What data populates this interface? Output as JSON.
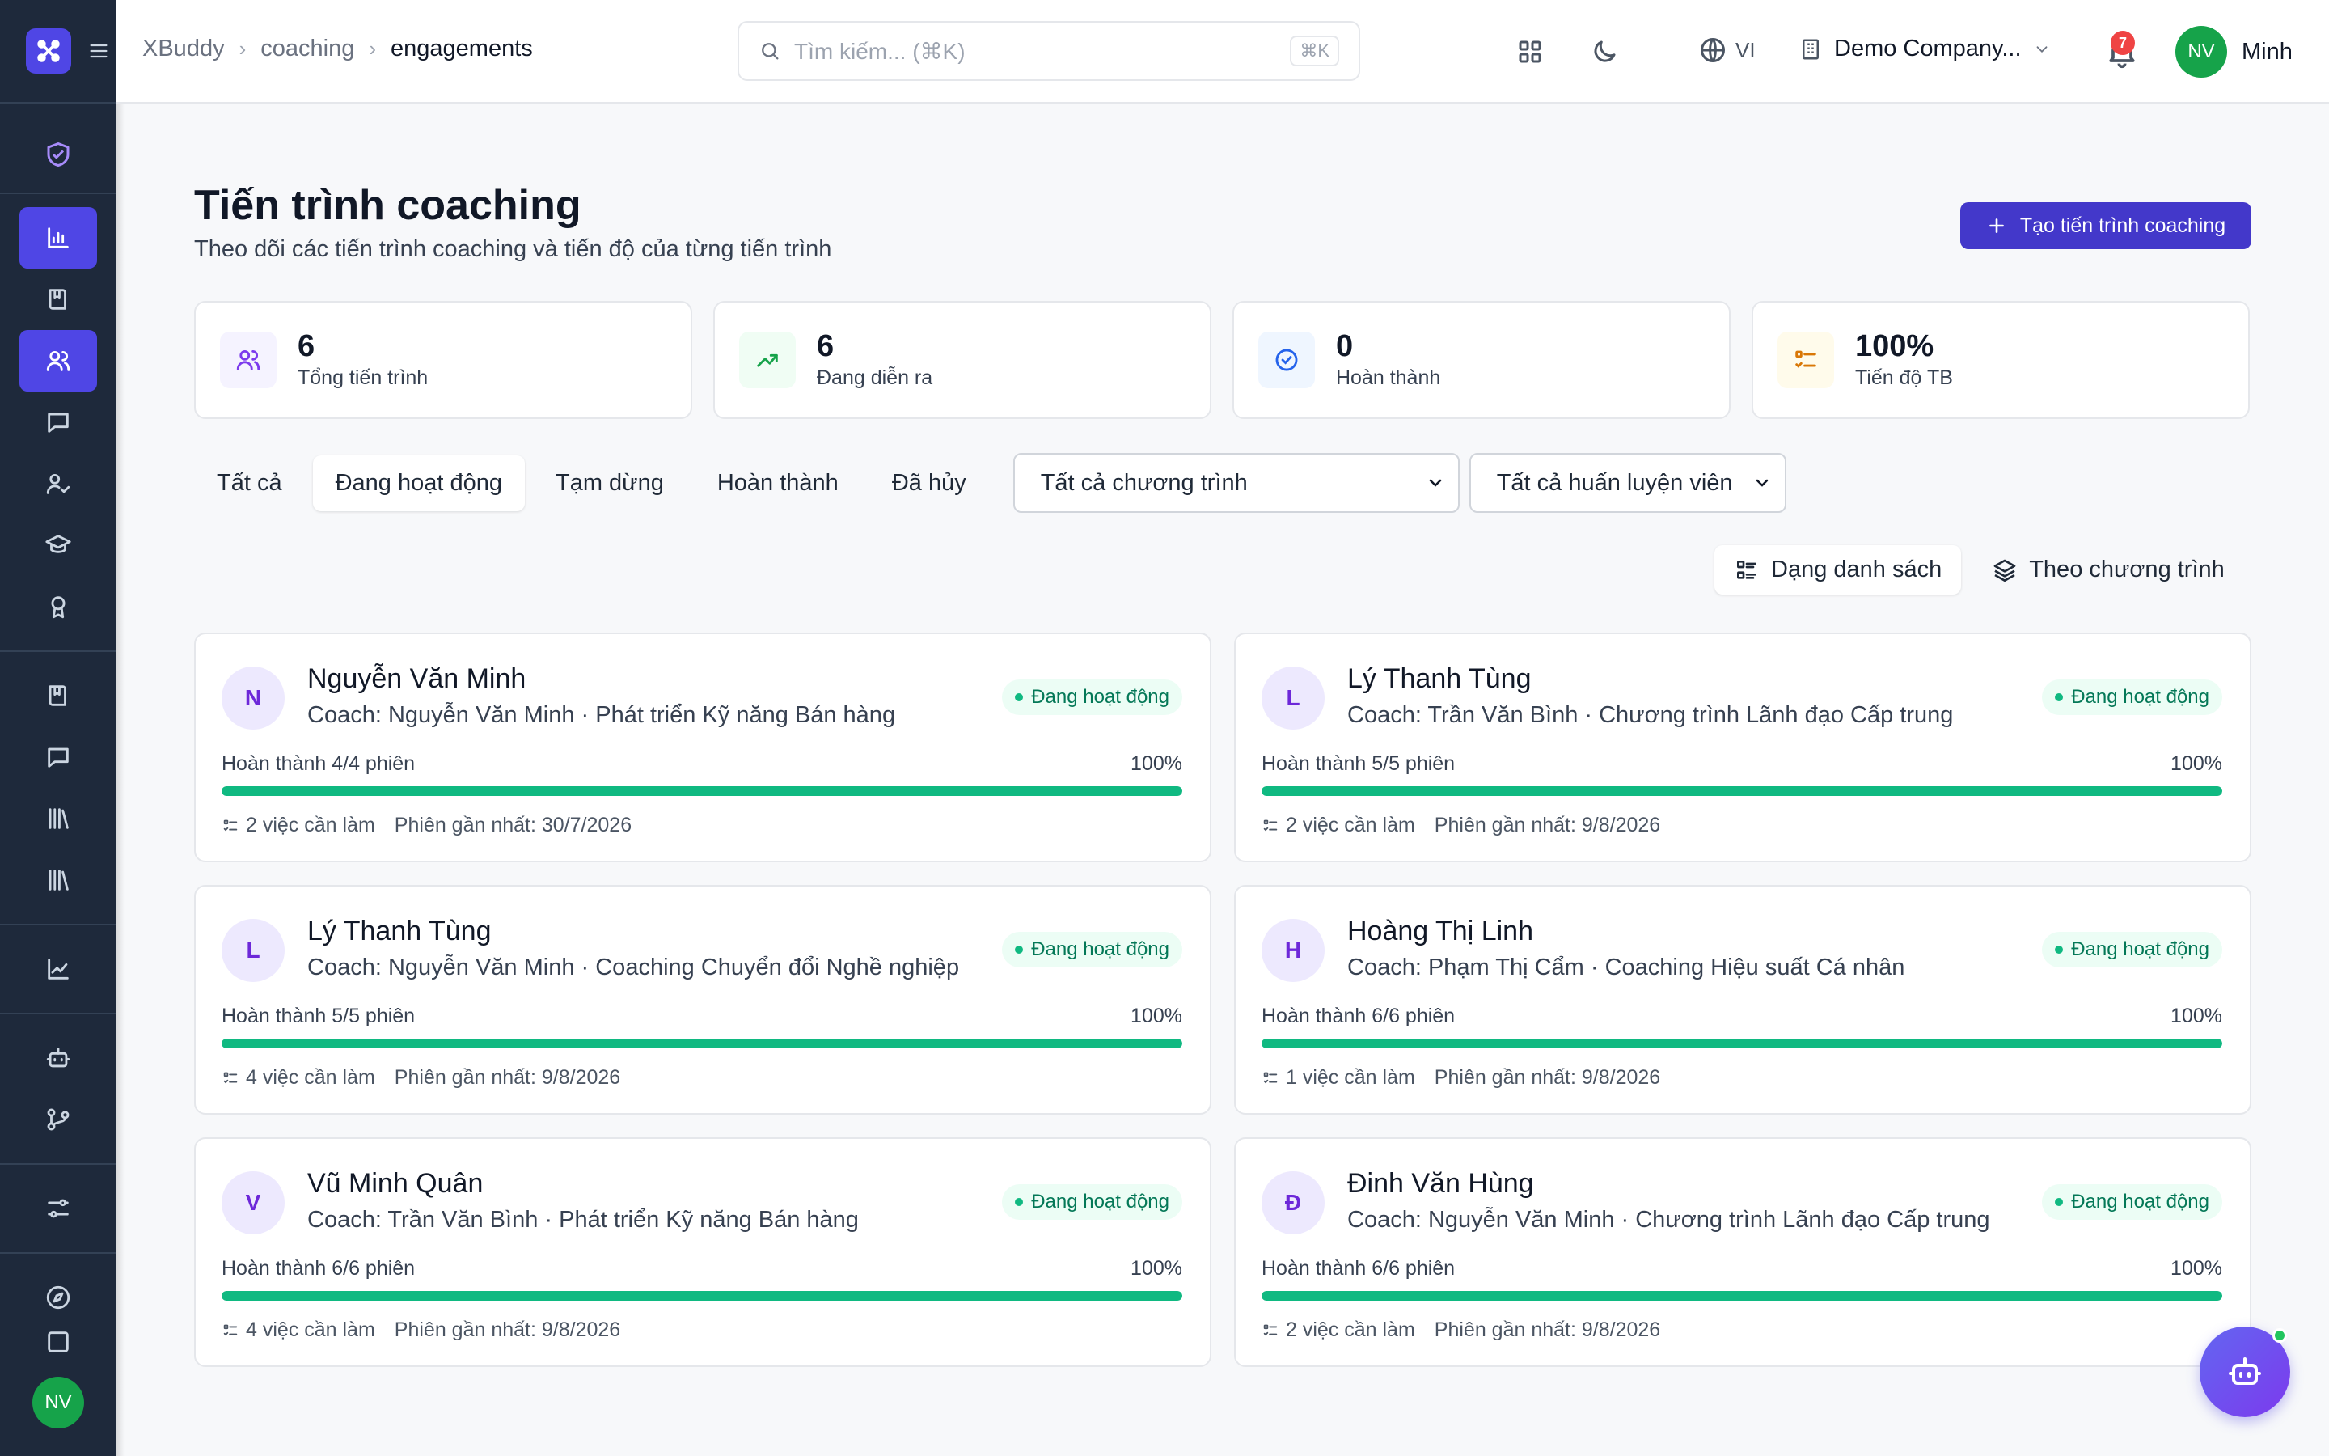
{
  "sidebar": {
    "user_initials": "NV"
  },
  "header": {
    "breadcrumb": [
      "XBuddy",
      "coaching",
      "engagements"
    ],
    "search_placeholder": "Tìm kiếm... (⌘K)",
    "search_shortcut": "⌘K",
    "language": "VI",
    "company": "Demo Company...",
    "notification_count": "7",
    "user_initials": "NV",
    "user_name": "Minh"
  },
  "page": {
    "title": "Tiến trình coaching",
    "subtitle": "Theo dõi các tiến trình coaching và tiến độ của từng tiến trình",
    "create_label": "Tạo tiến trình coaching"
  },
  "stats": [
    {
      "value": "6",
      "label": "Tổng tiến trình",
      "icon": "users-icon",
      "color": "#7c3aed",
      "bg": "#f5f3ff"
    },
    {
      "value": "6",
      "label": "Đang diễn ra",
      "icon": "trending-up-icon",
      "color": "#16a34a",
      "bg": "#f0fdf4"
    },
    {
      "value": "0",
      "label": "Hoàn thành",
      "icon": "check-circle-icon",
      "color": "#2563eb",
      "bg": "#eff6ff"
    },
    {
      "value": "100%",
      "label": "Tiến độ TB",
      "icon": "list-check-icon",
      "color": "#d97706",
      "bg": "#fffbeb"
    }
  ],
  "filters": {
    "tabs": [
      "Tất cả",
      "Đang hoạt động",
      "Tạm dừng",
      "Hoàn thành",
      "Đã hủy"
    ],
    "selected_tab": "Đang hoạt động",
    "program_select": "Tất cả chương trình",
    "coach_select": "Tất cả huấn luyện viên"
  },
  "view_options": [
    "Dạng danh sách",
    "Theo chương trình"
  ],
  "engagements": [
    {
      "initial": "N",
      "name": "Nguyễn Văn Minh",
      "meta": "Coach: Nguyễn Văn Minh · Phát triển Kỹ năng Bán hàng",
      "status": "Đang hoạt động",
      "progress_label": "Hoàn thành 4/4 phiên",
      "progress_pct": "100%",
      "progress": 1.0,
      "todos": "2 việc cần làm",
      "last_session": "Phiên gần nhất: 30/7/2026"
    },
    {
      "initial": "L",
      "name": "Lý Thanh Tùng",
      "meta": "Coach: Trần Văn Bình · Chương trình Lãnh đạo Cấp trung",
      "status": "Đang hoạt động",
      "progress_label": "Hoàn thành 5/5 phiên",
      "progress_pct": "100%",
      "progress": 1.0,
      "todos": "2 việc cần làm",
      "last_session": "Phiên gần nhất: 9/8/2026"
    },
    {
      "initial": "L",
      "name": "Lý Thanh Tùng",
      "meta": "Coach: Nguyễn Văn Minh · Coaching Chuyển đổi Nghề nghiệp",
      "status": "Đang hoạt động",
      "progress_label": "Hoàn thành 5/5 phiên",
      "progress_pct": "100%",
      "progress": 1.0,
      "todos": "4 việc cần làm",
      "last_session": "Phiên gần nhất: 9/8/2026"
    },
    {
      "initial": "H",
      "name": "Hoàng Thị Linh",
      "meta": "Coach: Phạm Thị Cẩm · Coaching Hiệu suất Cá nhân",
      "status": "Đang hoạt động",
      "progress_label": "Hoàn thành 6/6 phiên",
      "progress_pct": "100%",
      "progress": 1.0,
      "todos": "1 việc cần làm",
      "last_session": "Phiên gần nhất: 9/8/2026"
    },
    {
      "initial": "V",
      "name": "Vũ Minh Quân",
      "meta": "Coach: Trần Văn Bình · Phát triển Kỹ năng Bán hàng",
      "status": "Đang hoạt động",
      "progress_label": "Hoàn thành 6/6 phiên",
      "progress_pct": "100%",
      "progress": 1.0,
      "todos": "4 việc cần làm",
      "last_session": "Phiên gần nhất: 9/8/2026"
    },
    {
      "initial": "Đ",
      "name": "Đinh Văn Hùng",
      "meta": "Coach: Nguyễn Văn Minh · Chương trình Lãnh đạo Cấp trung",
      "status": "Đang hoạt động",
      "progress_label": "Hoàn thành 6/6 phiên",
      "progress_pct": "100%",
      "progress": 1.0,
      "todos": "2 việc cần làm",
      "last_session": "Phiên gần nhất: 9/8/2026"
    }
  ],
  "colors": {
    "accent": "#4f46e5",
    "success": "#10b981",
    "sidebar": "#1e293b"
  }
}
